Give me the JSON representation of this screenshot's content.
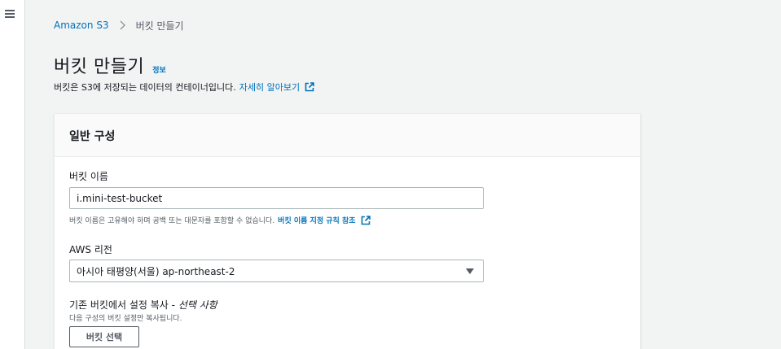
{
  "nav": {
    "menu_icon": "hamburger-menu-icon"
  },
  "breadcrumb": {
    "root": "Amazon S3",
    "current": "버킷 만들기"
  },
  "header": {
    "title": "버킷 만들기",
    "info_link": "정보",
    "description": "버킷은 S3에 저장되는 데이터의 컨테이너입니다.",
    "learn_more": "자세히 알아보기"
  },
  "general_config": {
    "title": "일반 구성",
    "bucket_name": {
      "label": "버킷 이름",
      "value": "i.mini-test-bucket",
      "hint": "버킷 이름은 고유해야 하며 공백 또는 대문자를 포함할 수 없습니다.",
      "hint_link": "버킷 이름 지정 규칙 참조"
    },
    "region": {
      "label": "AWS 리전",
      "selected": "아시아 태평양(서울) ap-northeast-2"
    },
    "copy_settings": {
      "label": "기존 버킷에서 설정 복사 -",
      "optional": "선택 사항",
      "description": "다음 구성의 버킷 설정만 복사됩니다.",
      "button": "버킷 선택"
    }
  },
  "colors": {
    "link": "#0073bb",
    "text": "#16191f",
    "muted": "#545b64",
    "background": "#f2f3f3",
    "border": "#aab7b8"
  }
}
